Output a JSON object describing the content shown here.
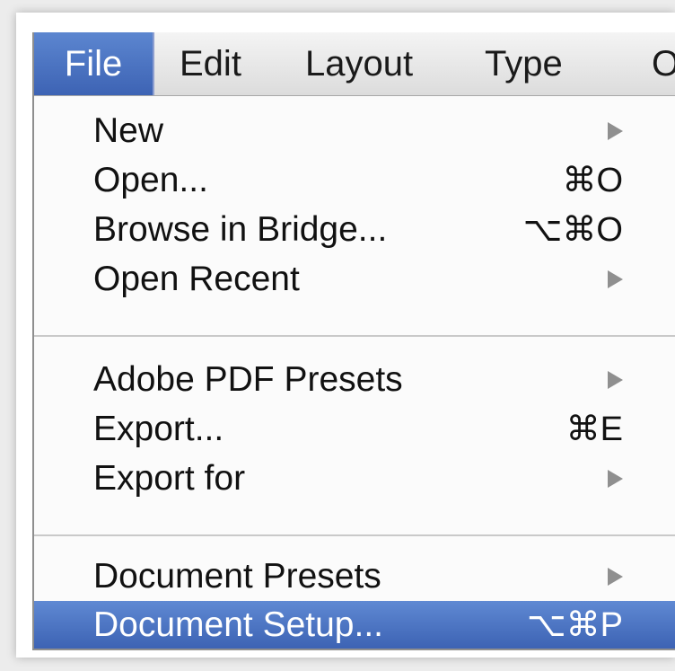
{
  "menubar": {
    "items": [
      {
        "label": "File"
      },
      {
        "label": "Edit"
      },
      {
        "label": "Layout"
      },
      {
        "label": "Type"
      },
      {
        "label": "O"
      }
    ]
  },
  "file_menu": {
    "items": [
      {
        "label": "New",
        "submenu": true
      },
      {
        "label": "Open...",
        "shortcut": "⌘O"
      },
      {
        "label": "Browse in Bridge...",
        "shortcut": "⌥⌘O"
      },
      {
        "label": "Open Recent",
        "submenu": true
      },
      {
        "label": "Adobe PDF Presets",
        "submenu": true
      },
      {
        "label": "Export...",
        "shortcut": "⌘E"
      },
      {
        "label": "Export for",
        "submenu": true
      },
      {
        "label": "Document Presets",
        "submenu": true
      },
      {
        "label": "Document Setup...",
        "shortcut": "⌥⌘P",
        "highlighted": true
      }
    ]
  },
  "colors": {
    "highlight": "#4a72c0",
    "submenu_arrow": "#8f8f8f"
  }
}
